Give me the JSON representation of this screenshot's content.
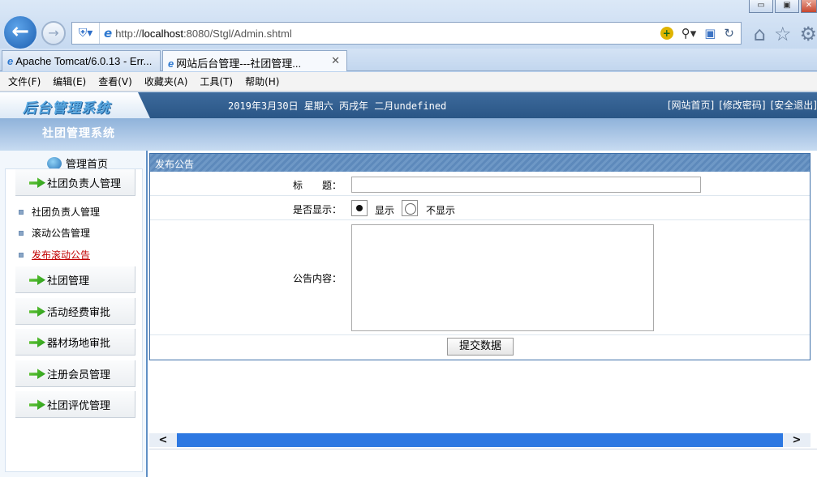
{
  "browser": {
    "address": {
      "prefix": "http://",
      "host": "localhost",
      "rest": ":8080/Stgl/Admin.shtml"
    },
    "window_buttons": [
      "▭",
      "▣",
      "✕"
    ],
    "tabs": [
      {
        "label": "Apache Tomcat/6.0.13 - Err..."
      },
      {
        "label": "网站后台管理---社团管理...",
        "close": "✕"
      }
    ],
    "menu": [
      "文件(F)",
      "编辑(E)",
      "查看(V)",
      "收藏夹(A)",
      "工具(T)",
      "帮助(H)"
    ]
  },
  "header": {
    "logo": "后台管理系统",
    "date": "2019年3月30日 星期六 丙戌年 二月undefined",
    "links": [
      "[网站首页]",
      "[修改密码]",
      "[安全退出]"
    ],
    "system_title": "社团管理系统"
  },
  "sidebar": {
    "home": "管理首页",
    "groups": [
      {
        "label": "社团负责人管理"
      },
      {
        "label": "社团管理"
      },
      {
        "label": "活动经费审批"
      },
      {
        "label": "器材场地审批"
      },
      {
        "label": "注册会员管理"
      },
      {
        "label": "社团评优管理"
      }
    ],
    "sub_items": [
      {
        "label": "社团负责人管理"
      },
      {
        "label": "滚动公告管理"
      },
      {
        "label": "发布滚动公告"
      }
    ]
  },
  "form": {
    "panel_title": "发布公告",
    "title_label": "标　　题：",
    "title_value": "",
    "show_label": "是否显示：",
    "show_yes": "显示",
    "show_no": "不显示",
    "content_label": "公告内容：",
    "content_value": "",
    "submit": "提交数据"
  },
  "icons": {
    "back": "arrow-left-icon",
    "forward": "arrow-right-icon",
    "home": "house-icon",
    "favorites": "star-icon",
    "tools": "gear-icon"
  }
}
